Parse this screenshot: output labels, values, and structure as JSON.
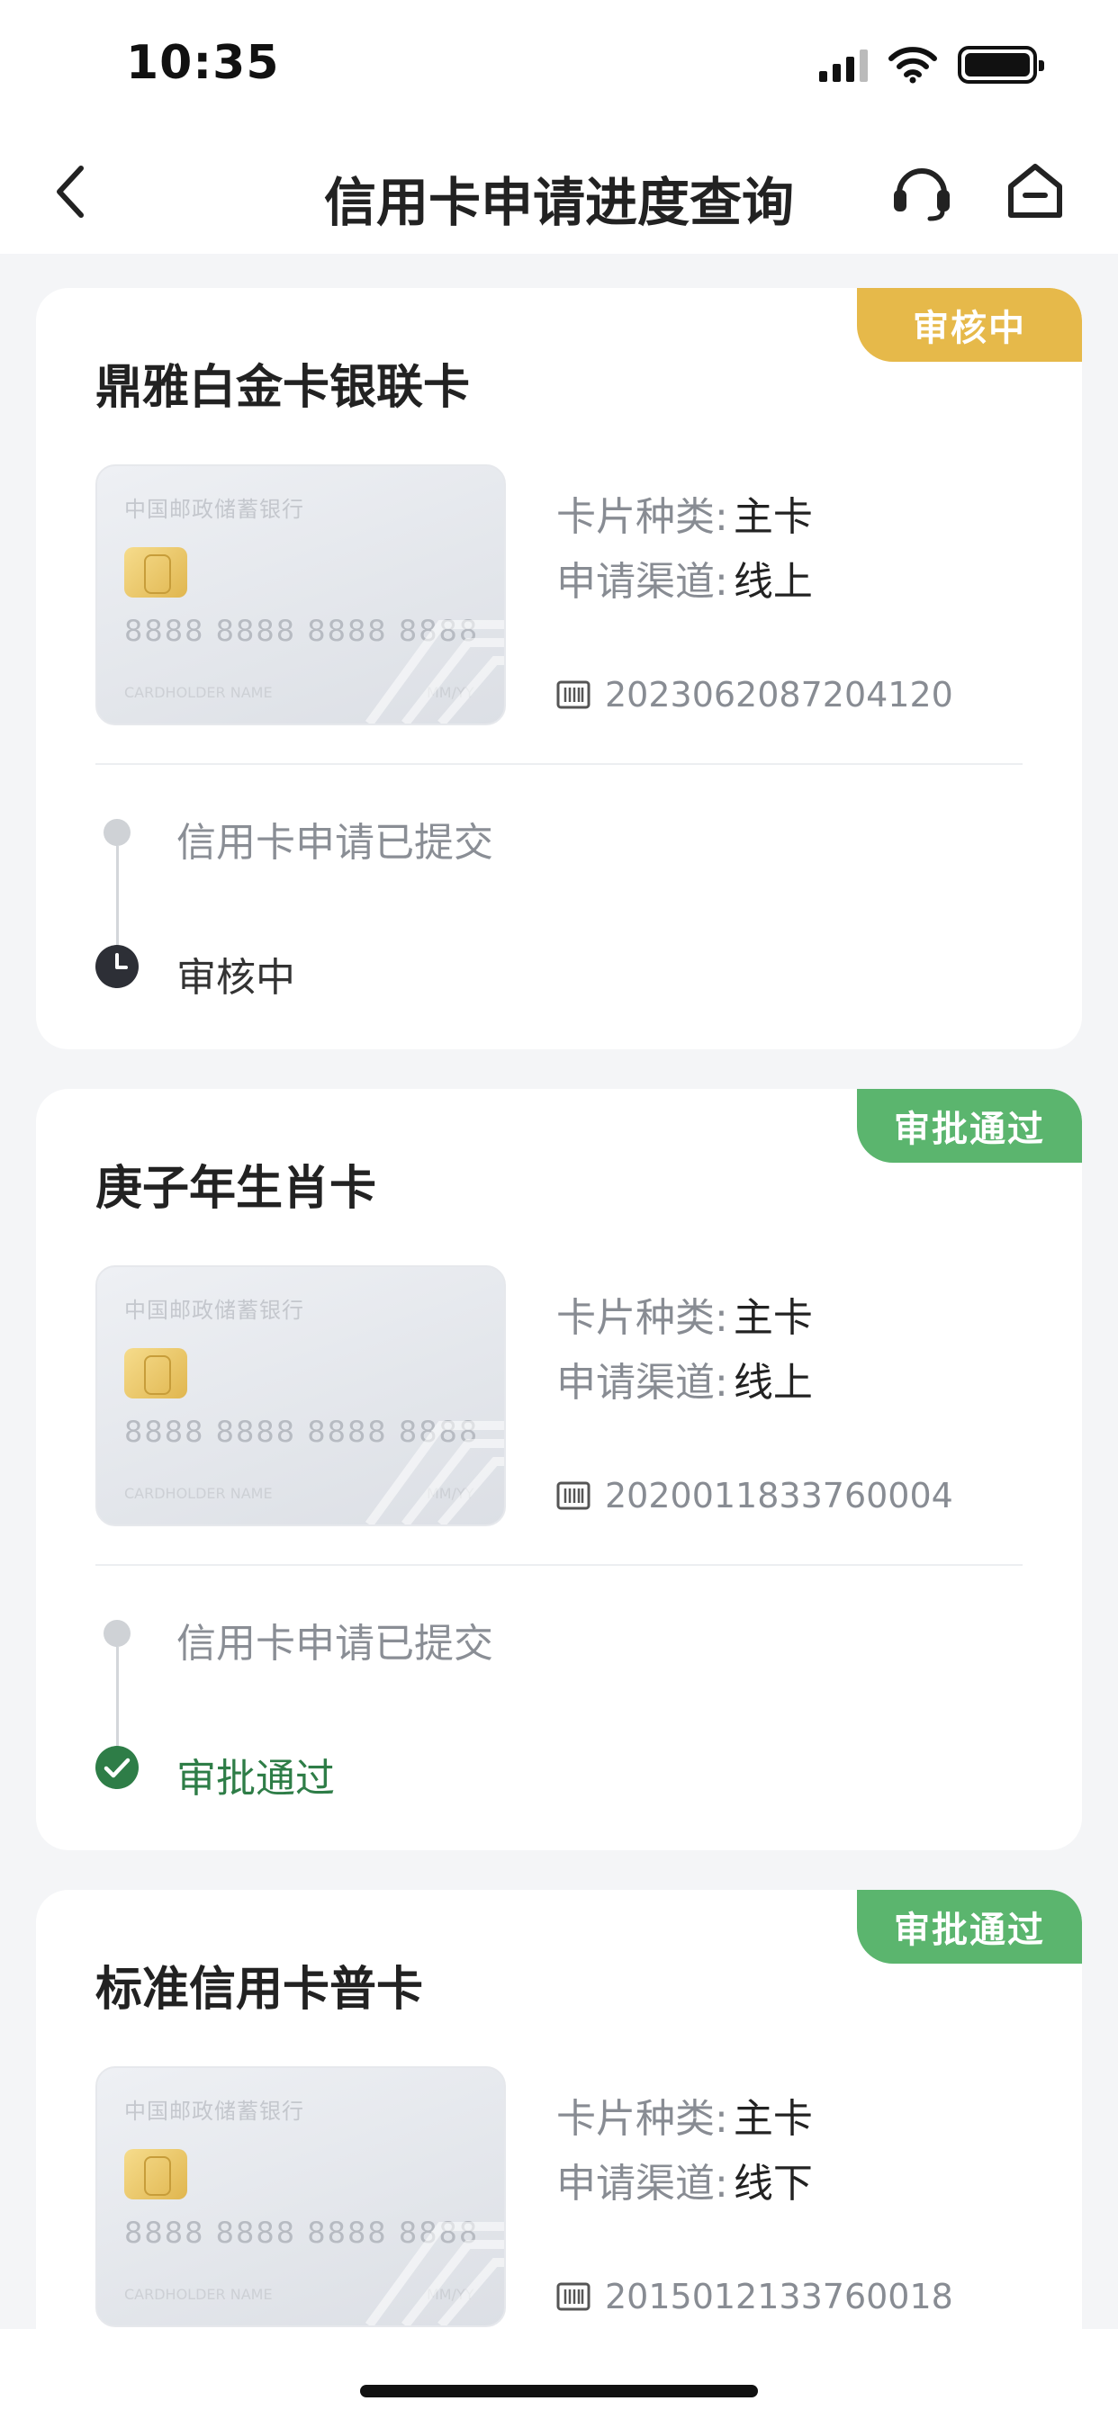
{
  "status_bar": {
    "time": "10:35"
  },
  "nav": {
    "title": "信用卡申请进度查询",
    "back_icon": "chevron-left-icon",
    "service_icon": "headset-icon",
    "home_icon": "home-icon"
  },
  "card_art": {
    "bank_name": "中国邮政储蓄银行",
    "number": "8888 8888 8888 8888",
    "holder": "CARDHOLDER NAME",
    "expiry": "MM/YY"
  },
  "labels": {
    "card_type": "卡片种类:",
    "channel": "申请渠道:",
    "submitted": "信用卡申请已提交"
  },
  "applications": [
    {
      "name": "鼎雅白金卡银联卡",
      "status_badge": "审核中",
      "status_color": "#e6b94a",
      "card_type": "主卡",
      "channel": "线上",
      "app_no": "2023062087204120",
      "current_step": "审核中",
      "step_color": "#333333",
      "step_icon": "clock-icon"
    },
    {
      "name": "庚子年生肖卡",
      "status_badge": "审批通过",
      "status_color": "#5bb56e",
      "card_type": "主卡",
      "channel": "线上",
      "app_no": "2020011833760004",
      "current_step": "审批通过",
      "step_color": "#2e7d47",
      "step_icon": "check-circle-icon"
    },
    {
      "name": "标准信用卡普卡",
      "status_badge": "审批通过",
      "status_color": "#5bb56e",
      "card_type": "主卡",
      "channel": "线下",
      "app_no": "2015012133760018"
    }
  ]
}
